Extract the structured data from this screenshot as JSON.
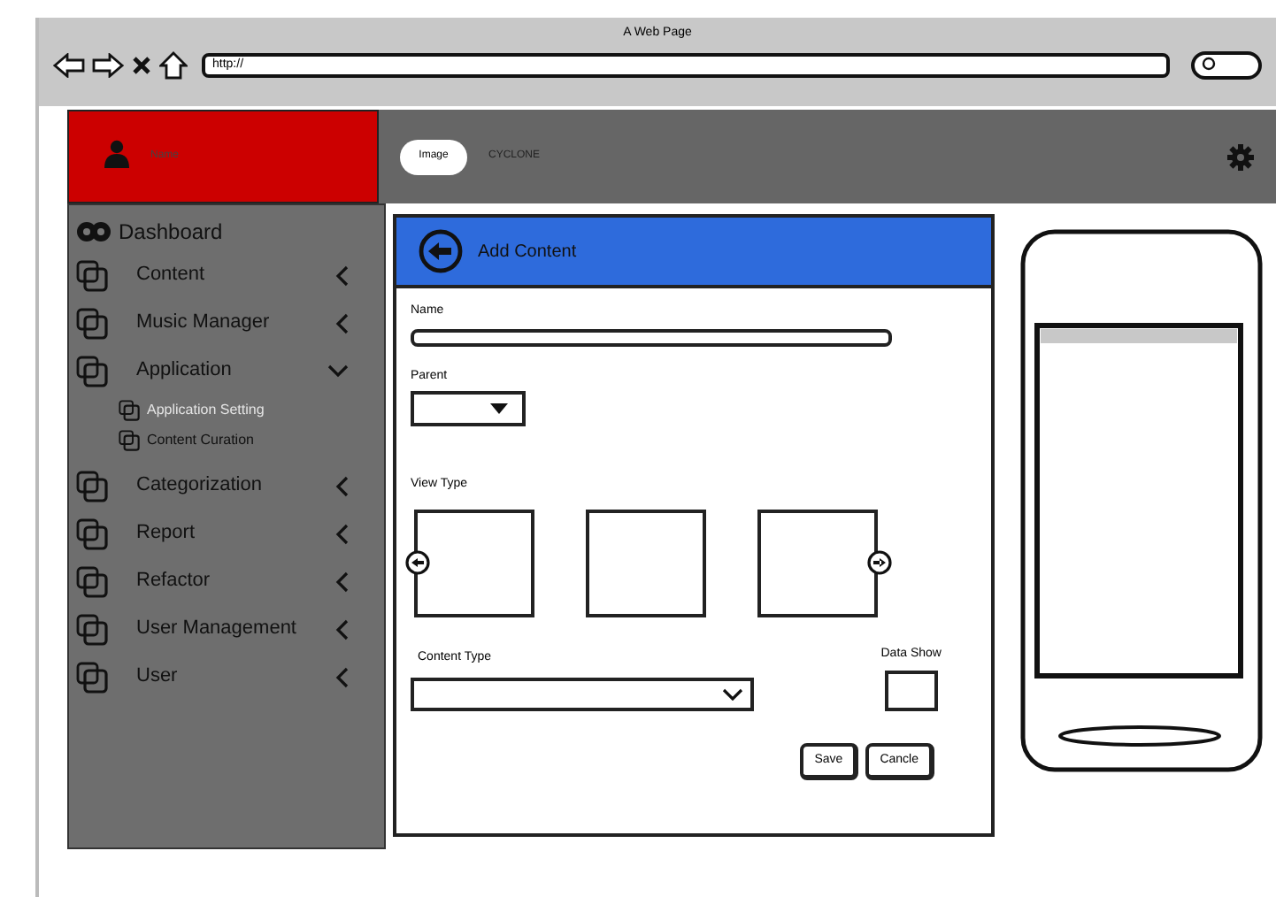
{
  "browser": {
    "title": "A Web Page",
    "url": "http://"
  },
  "header": {
    "user_name": "Name",
    "logo": "Image",
    "app_name": "CYCLONE"
  },
  "sidebar": {
    "items": [
      {
        "kind": "dashboard",
        "label": "Dashboard"
      },
      {
        "kind": "menu",
        "label": "Content",
        "expanded": false
      },
      {
        "kind": "menu",
        "label": "Music Manager",
        "expanded": false
      },
      {
        "kind": "menu",
        "label": "Application",
        "expanded": true,
        "children": [
          {
            "label": "Application Setting",
            "selected": true
          },
          {
            "label": "Content Curation",
            "selected": false
          }
        ]
      },
      {
        "kind": "menu",
        "label": "Categorization",
        "expanded": false
      },
      {
        "kind": "menu",
        "label": "Report",
        "expanded": false
      },
      {
        "kind": "menu",
        "label": "Refactor",
        "expanded": false
      },
      {
        "kind": "menu",
        "label": "User Management",
        "expanded": false
      },
      {
        "kind": "menu",
        "label": "User",
        "expanded": false
      }
    ]
  },
  "form": {
    "title": "Add Content",
    "name_label": "Name",
    "parent_label": "Parent",
    "view_type_label": "View Type",
    "content_type_label": "Content Type",
    "data_show_label": "Data Show",
    "data_show_checked": false,
    "buttons": [
      "Save",
      "Cancle"
    ]
  }
}
